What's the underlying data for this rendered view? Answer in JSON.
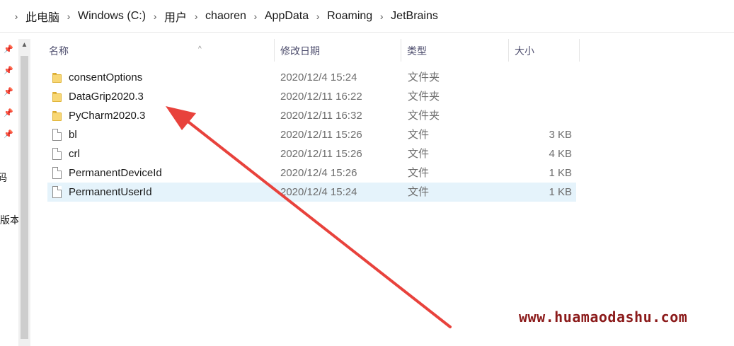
{
  "breadcrumb": {
    "items": [
      "此电脑",
      "Windows (C:)",
      "用户",
      "chaoren",
      "AppData",
      "Roaming",
      "JetBrains"
    ],
    "separator": "›"
  },
  "nav_pane": {
    "partial_labels": [
      "码",
      "版本"
    ]
  },
  "columns": {
    "name": "名称",
    "modified": "修改日期",
    "type": "类型",
    "size": "大小"
  },
  "files": [
    {
      "name": "consentOptions",
      "modified": "2020/12/4 15:24",
      "type": "文件夹",
      "size": "",
      "icon": "folder-icon"
    },
    {
      "name": "DataGrip2020.3",
      "modified": "2020/12/11 16:22",
      "type": "文件夹",
      "size": "",
      "icon": "folder-icon"
    },
    {
      "name": "PyCharm2020.3",
      "modified": "2020/12/11 16:32",
      "type": "文件夹",
      "size": "",
      "icon": "folder-icon"
    },
    {
      "name": "bl",
      "modified": "2020/12/11 15:26",
      "type": "文件",
      "size": "3 KB",
      "icon": "file-icon"
    },
    {
      "name": "crl",
      "modified": "2020/12/11 15:26",
      "type": "文件",
      "size": "4 KB",
      "icon": "file-icon"
    },
    {
      "name": "PermanentDeviceId",
      "modified": "2020/12/4 15:26",
      "type": "文件",
      "size": "1 KB",
      "icon": "file-icon"
    },
    {
      "name": "PermanentUserId",
      "modified": "2020/12/4 15:24",
      "type": "文件",
      "size": "1 KB",
      "icon": "file-icon",
      "selected": true
    }
  ],
  "watermark": "www.huamaodashu.com",
  "colors": {
    "selection": "#e5f3fb",
    "annotation_arrow": "#e8423c",
    "watermark": "#8b1a1a",
    "folder": "#f8d775"
  }
}
